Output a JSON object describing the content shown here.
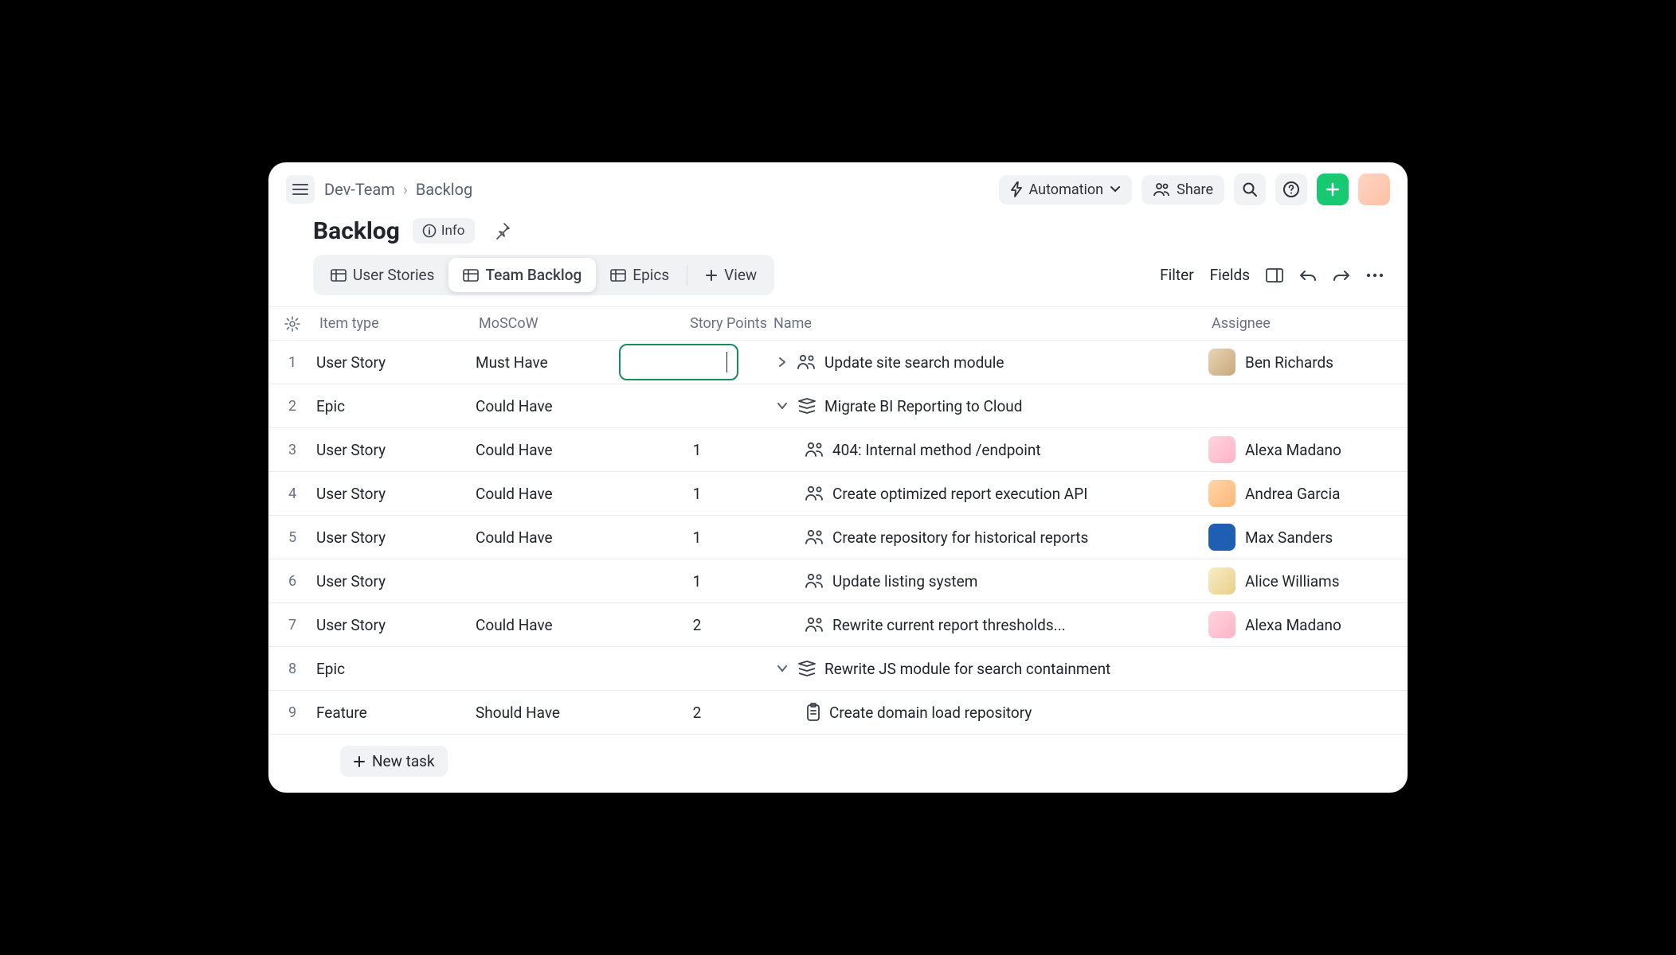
{
  "breadcrumb": {
    "project": "Dev-Team",
    "section": "Backlog"
  },
  "header": {
    "automation": "Automation",
    "share": "Share"
  },
  "title": "Backlog",
  "info": "Info",
  "tabs": {
    "user_stories": "User Stories",
    "team_backlog": "Team Backlog",
    "epics": "Epics",
    "add_view": "View"
  },
  "view_actions": {
    "filter": "Filter",
    "fields": "Fields"
  },
  "columns": {
    "item_type": "Item type",
    "moscow": "MoSCoW",
    "story_points": "Story Points",
    "name": "Name",
    "assignee": "Assignee"
  },
  "rows": [
    {
      "num": "1",
      "type": "User Story",
      "moscow": "Must Have",
      "points": "",
      "points_editing": true,
      "name": "Update site search module",
      "kind": "story",
      "toggle": "right",
      "indent": 0,
      "assignee": "Ben Richards",
      "avatar": "av-brown"
    },
    {
      "num": "2",
      "type": "Epic",
      "moscow": "Could Have",
      "points": "",
      "name": "Migrate BI Reporting to Cloud",
      "kind": "epic",
      "toggle": "down",
      "indent": 0,
      "assignee": "",
      "avatar": ""
    },
    {
      "num": "3",
      "type": "User Story",
      "moscow": "Could Have",
      "points": "1",
      "name": "404: Internal method /endpoint",
      "kind": "story",
      "toggle": "",
      "indent": 1,
      "assignee": "Alexa Madano",
      "avatar": "av-pink"
    },
    {
      "num": "4",
      "type": "User Story",
      "moscow": "Could Have",
      "points": "1",
      "name": "Create optimized report execution API",
      "kind": "story",
      "toggle": "",
      "indent": 1,
      "assignee": "Andrea Garcia",
      "avatar": "av-orange"
    },
    {
      "num": "5",
      "type": "User Story",
      "moscow": "Could Have",
      "points": "1",
      "name": "Create repository for historical reports",
      "kind": "story",
      "toggle": "",
      "indent": 1,
      "assignee": "Max Sanders",
      "avatar": "av-blue"
    },
    {
      "num": "6",
      "type": "User Story",
      "moscow": "",
      "points": "1",
      "name": "Update listing system",
      "kind": "story",
      "toggle": "",
      "indent": 1,
      "assignee": "Alice Williams",
      "avatar": "av-blonde"
    },
    {
      "num": "7",
      "type": "User Story",
      "moscow": "Could Have",
      "points": "2",
      "name": "Rewrite current report thresholds...",
      "kind": "story",
      "toggle": "",
      "indent": 1,
      "assignee": "Alexa Madano",
      "avatar": "av-pink"
    },
    {
      "num": "8",
      "type": "Epic",
      "moscow": "",
      "points": "",
      "name": "Rewrite JS module for search containment",
      "kind": "epic",
      "toggle": "down",
      "indent": 0,
      "assignee": "",
      "avatar": ""
    },
    {
      "num": "9",
      "type": "Feature",
      "moscow": "Should Have",
      "points": "2",
      "name": "Create domain load repository",
      "kind": "feature",
      "toggle": "",
      "indent": 1,
      "assignee": "",
      "avatar": ""
    }
  ],
  "new_task": "New task"
}
